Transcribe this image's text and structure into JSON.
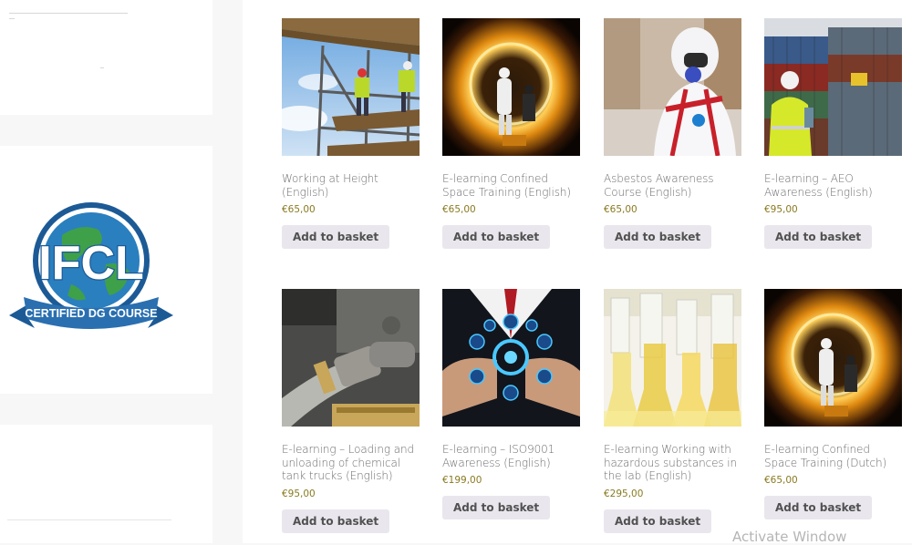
{
  "sidebar": {
    "logo": {
      "letters": "IFCL",
      "ribbon_text": "CERTIFIED DG COURSE",
      "colors": {
        "ring": "#1c5a96",
        "globe_blue": "#2a7fbf",
        "globe_green": "#3fa04a",
        "ribbon": "#2a6fb0"
      }
    }
  },
  "products": [
    {
      "title": "Working at Height (English)",
      "price": "€65,00",
      "button": "Add to basket",
      "image": "scaffolding-workers-photo"
    },
    {
      "title": "E-learning Confined Space Training (English)",
      "price": "€65,00",
      "button": "Add to basket",
      "image": "confined-space-tunnel-photo"
    },
    {
      "title": "Asbestos Awareness Course (English)",
      "price": "€65,00",
      "button": "Add to basket",
      "image": "asbestos-suit-worker-photo"
    },
    {
      "title": "E-learning – AEO Awareness (English)",
      "price": "€95,00",
      "button": "Add to basket",
      "image": "container-yard-worker-photo"
    },
    {
      "title": "E-learning – Loading and unloading of chemical tank trucks (English)",
      "price": "€95,00",
      "button": "Add to basket",
      "image": "tank-hose-coupling-photo"
    },
    {
      "title": "E-learning – ISO9001 Awareness (English)",
      "price": "€199,00",
      "button": "Add to basket",
      "image": "iso-gear-network-photo"
    },
    {
      "title": "E-learning Working with hazardous substances in the lab (English)",
      "price": "€295,00",
      "button": "Add to basket",
      "image": "lab-flasks-photo"
    },
    {
      "title": "E-learning Confined Space Training (Dutch)",
      "price": "€65,00",
      "button": "Add to basket",
      "image": "confined-space-tunnel-photo"
    }
  ],
  "watermark": "Activate Window"
}
